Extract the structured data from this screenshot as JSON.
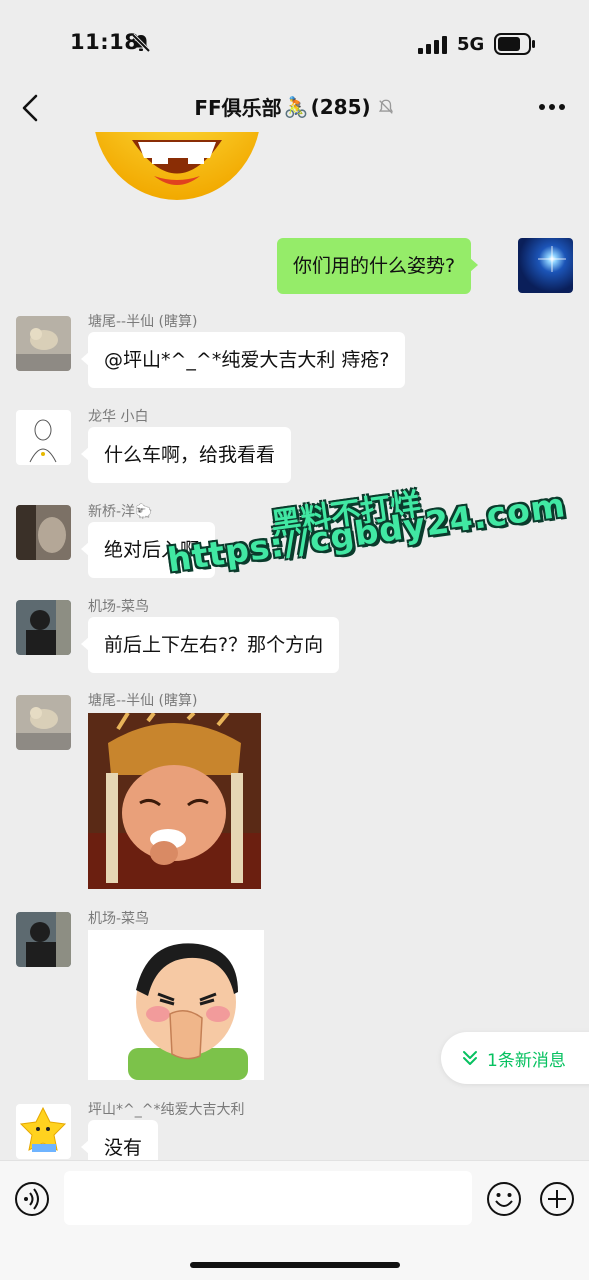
{
  "status_bar": {
    "time": "11:18",
    "network": "5G"
  },
  "header": {
    "title": "FF俱乐部",
    "title_emoji": "🚴",
    "member_count": "(285)"
  },
  "messages": [
    {
      "side": "right",
      "type": "text",
      "text": "你们用的什么姿势?"
    },
    {
      "side": "left",
      "sender": "塘尾--半仙 (瞎算)",
      "type": "text",
      "text": "@坪山*^_^*纯爱大吉大利 痔疮?"
    },
    {
      "side": "left",
      "sender": "龙华  小白",
      "type": "text",
      "text": "什么车啊，给我看看"
    },
    {
      "side": "left",
      "sender": "新桥-洋🐑",
      "type": "text",
      "text": "绝对后入啊"
    },
    {
      "side": "left",
      "sender": "机场-菜鸟",
      "type": "text",
      "text": "前后上下左右?？那个方向"
    },
    {
      "side": "left",
      "sender": "塘尾--半仙 (瞎算)",
      "type": "sticker",
      "sticker": "laughing-monk-sticker"
    },
    {
      "side": "left",
      "sender": "机场-菜鸟",
      "type": "sticker",
      "sticker": "covering-nose-sticker"
    },
    {
      "side": "left",
      "sender": "坪山*^_^*纯爱大吉大利",
      "type": "text",
      "text": "没有"
    }
  ],
  "watermark": {
    "line1": "黑料不打烊",
    "line2": "https://cgbdy24.com"
  },
  "new_messages_pill": {
    "label": "1条新消息",
    "icon": "double-chevron-down-icon"
  },
  "input_bar": {
    "placeholder": ""
  },
  "colors": {
    "background": "#ededed",
    "my_bubble": "#95ec69",
    "other_bubble": "#ffffff",
    "accent": "#07c160",
    "watermark": "#41e8a3"
  },
  "icons": [
    "back-arrow-icon",
    "bell-off-icon",
    "signal-icon",
    "battery-icon",
    "more-dots-icon",
    "voice-icon",
    "emoji-icon",
    "plus-icon"
  ]
}
